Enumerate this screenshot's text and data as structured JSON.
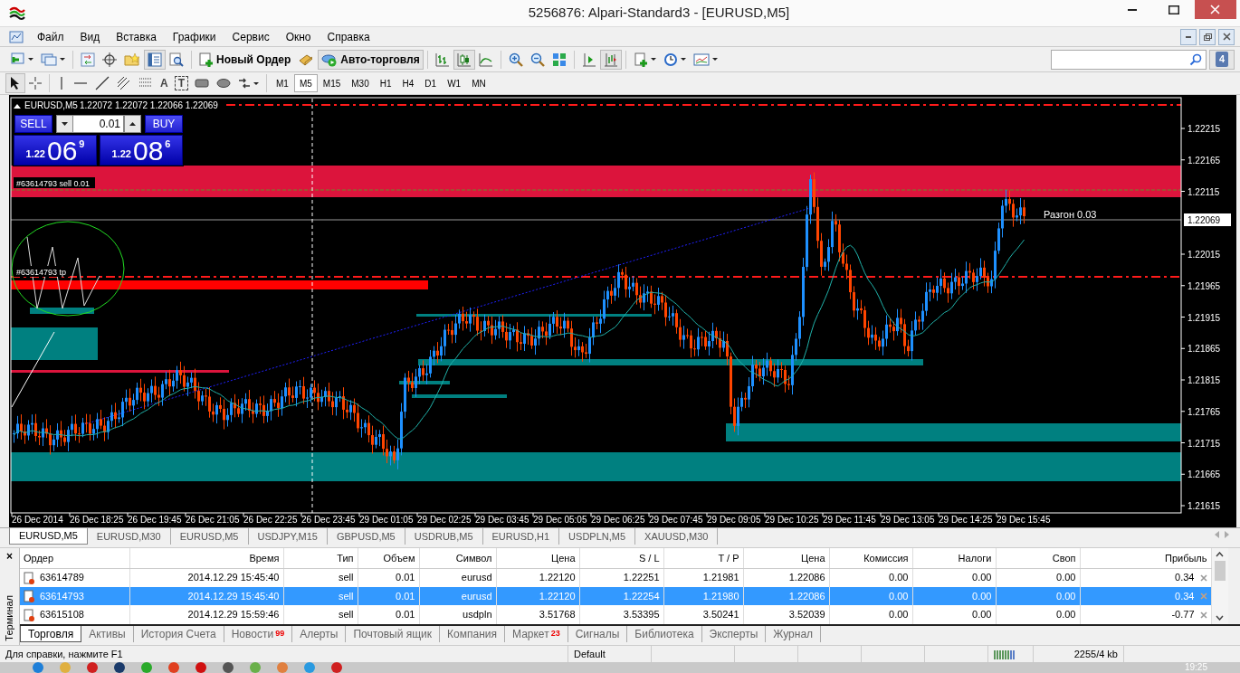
{
  "window": {
    "title": "5256876: Alpari-Standard3 - [EURUSD,M5]"
  },
  "menu": [
    "Файл",
    "Вид",
    "Вставка",
    "Графики",
    "Сервис",
    "Окно",
    "Справка"
  ],
  "toolbar": {
    "new_order": "Новый Ордер",
    "auto_trading": "Авто-торговля",
    "messages_count": "4"
  },
  "drawing_tools": {
    "text_tool": "A",
    "text_label_tool": "T"
  },
  "timeframes": [
    {
      "label": "M1",
      "selected": false
    },
    {
      "label": "M5",
      "selected": true
    },
    {
      "label": "M15",
      "selected": false
    },
    {
      "label": "M30",
      "selected": false
    },
    {
      "label": "H1",
      "selected": false
    },
    {
      "label": "H4",
      "selected": false
    },
    {
      "label": "D1",
      "selected": false
    },
    {
      "label": "W1",
      "selected": false
    },
    {
      "label": "MN",
      "selected": false
    }
  ],
  "chart": {
    "header": {
      "symbol": "EURUSD,M5",
      "ohlc": "1.22072 1.22072 1.22066 1.22069"
    },
    "one_click": {
      "sell_label": "SELL",
      "buy_label": "BUY",
      "lot": "0.01",
      "bid": {
        "big": "1.22",
        "main": "06",
        "small": "9"
      },
      "ask": {
        "big": "1.22",
        "main": "08",
        "small": "6"
      }
    },
    "object_labels": [
      "#63614793 sell 0.01",
      "#63614793 tp",
      "Разгон 0.03"
    ],
    "price_axis": [
      "1.22215",
      "1.22165",
      "1.22115",
      "1.22015",
      "1.21965",
      "1.21915",
      "1.21865",
      "1.21815",
      "1.21765",
      "1.21715",
      "1.21665",
      "1.21615"
    ],
    "current_price": "1.22069",
    "time_axis": [
      "26 Dec 2014",
      "26 Dec 18:25",
      "26 Dec 19:45",
      "26 Dec 21:05",
      "26 Dec 22:25",
      "26 Dec 23:45",
      "29 Dec 01:05",
      "29 Dec 02:25",
      "29 Dec 03:45",
      "29 Dec 05:05",
      "29 Dec 06:25",
      "29 Dec 07:45",
      "29 Dec 09:05",
      "29 Dec 10:25",
      "29 Dec 11:45",
      "29 Dec 13:05",
      "29 Dec 14:25",
      "29 Dec 15:45"
    ]
  },
  "chart_tabs": [
    {
      "label": "EURUSD,M5",
      "selected": true
    },
    {
      "label": "EURUSD,M30",
      "selected": false
    },
    {
      "label": "EURUSD,M5",
      "selected": false
    },
    {
      "label": "USDJPY,M15",
      "selected": false
    },
    {
      "label": "GBPUSD,M5",
      "selected": false
    },
    {
      "label": "USDRUB,M5",
      "selected": false
    },
    {
      "label": "EURUSD,H1",
      "selected": false
    },
    {
      "label": "USDPLN,M5",
      "selected": false
    },
    {
      "label": "XAUUSD,M30",
      "selected": false
    }
  ],
  "terminal": {
    "side_label": "Терминал",
    "close": "×",
    "columns": [
      "Ордер",
      "Время",
      "Тип",
      "Объем",
      "Символ",
      "Цена",
      "S / L",
      "T / P",
      "Цена",
      "Комиссия",
      "Налоги",
      "Своп",
      "Прибыль"
    ],
    "rows": [
      {
        "cells": [
          "63614789",
          "2014.12.29 15:45:40",
          "sell",
          "0.01",
          "eurusd",
          "1.22120",
          "1.22251",
          "1.21981",
          "1.22086",
          "0.00",
          "0.00",
          "0.00",
          "0.34"
        ],
        "selected": false
      },
      {
        "cells": [
          "63614793",
          "2014.12.29 15:45:40",
          "sell",
          "0.01",
          "eurusd",
          "1.22120",
          "1.22254",
          "1.21980",
          "1.22086",
          "0.00",
          "0.00",
          "0.00",
          "0.34"
        ],
        "selected": true
      },
      {
        "cells": [
          "63615108",
          "2014.12.29 15:59:46",
          "sell",
          "0.01",
          "usdpln",
          "3.51768",
          "3.53395",
          "3.50241",
          "3.52039",
          "0.00",
          "0.00",
          "0.00",
          "-0.77"
        ],
        "selected": false
      }
    ],
    "tabs": [
      {
        "label": "Торговля",
        "selected": true
      },
      {
        "label": "Активы",
        "selected": false
      },
      {
        "label": "История Счета",
        "selected": false
      },
      {
        "label": "Новости",
        "count": "99",
        "selected": false
      },
      {
        "label": "Алерты",
        "selected": false
      },
      {
        "label": "Почтовый ящик",
        "selected": false
      },
      {
        "label": "Компания",
        "selected": false
      },
      {
        "label": "Маркет",
        "count": "23",
        "selected": false
      },
      {
        "label": "Сигналы",
        "selected": false
      },
      {
        "label": "Библиотека",
        "selected": false
      },
      {
        "label": "Эксперты",
        "selected": false
      },
      {
        "label": "Журнал",
        "selected": false
      }
    ]
  },
  "status_bar": {
    "help": "Для справки, нажмите F1",
    "profile": "Default",
    "traffic": "2255/4 kb"
  },
  "taskbar": {
    "clock": "19:25"
  }
}
